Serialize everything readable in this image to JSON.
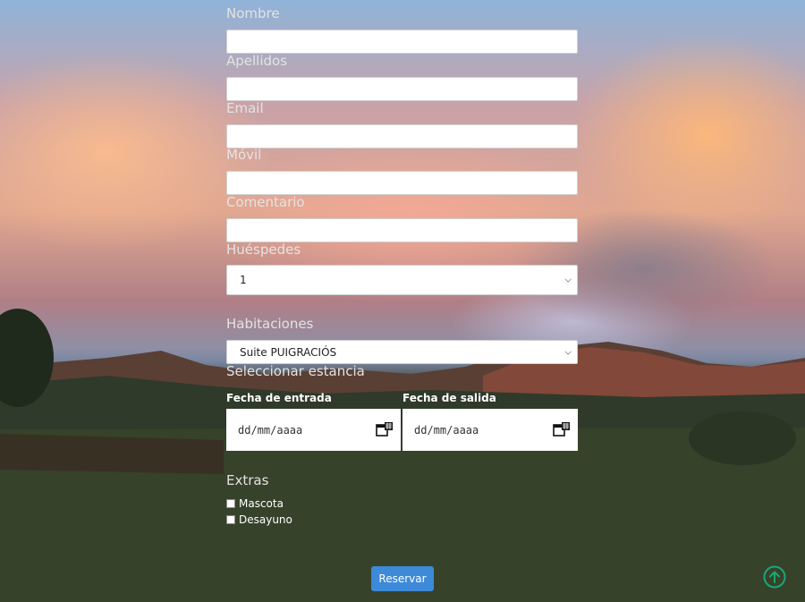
{
  "form": {
    "fields": [
      {
        "label": "Nombre"
      },
      {
        "label": "Apellidos"
      },
      {
        "label": "Email"
      },
      {
        "label": "Móvil"
      },
      {
        "label": "Comentario"
      }
    ],
    "guests": {
      "label": "Huéspedes",
      "selected": "1"
    },
    "rooms": {
      "label": "Habitaciones",
      "selected": "Suite PUIGRACIÓS"
    },
    "stay": {
      "label": "Seleccionar estancia",
      "checkin": {
        "label": "Fecha de entrada",
        "placeholder": "dd/mm/aaaa"
      },
      "checkout": {
        "label": "Fecha de salida",
        "placeholder": "dd/mm/aaaa"
      }
    },
    "extras": {
      "label": "Extras",
      "options": [
        "Mascota",
        "Desayuno"
      ]
    },
    "submit_label": "Reservar"
  },
  "colors": {
    "button": "#3d8ad8",
    "scroll_top": "#1aa678"
  },
  "icons": {
    "calendar": "calendar-icon",
    "scroll_top": "arrow-up-circle-icon",
    "chevron": "chevron-down-icon"
  }
}
